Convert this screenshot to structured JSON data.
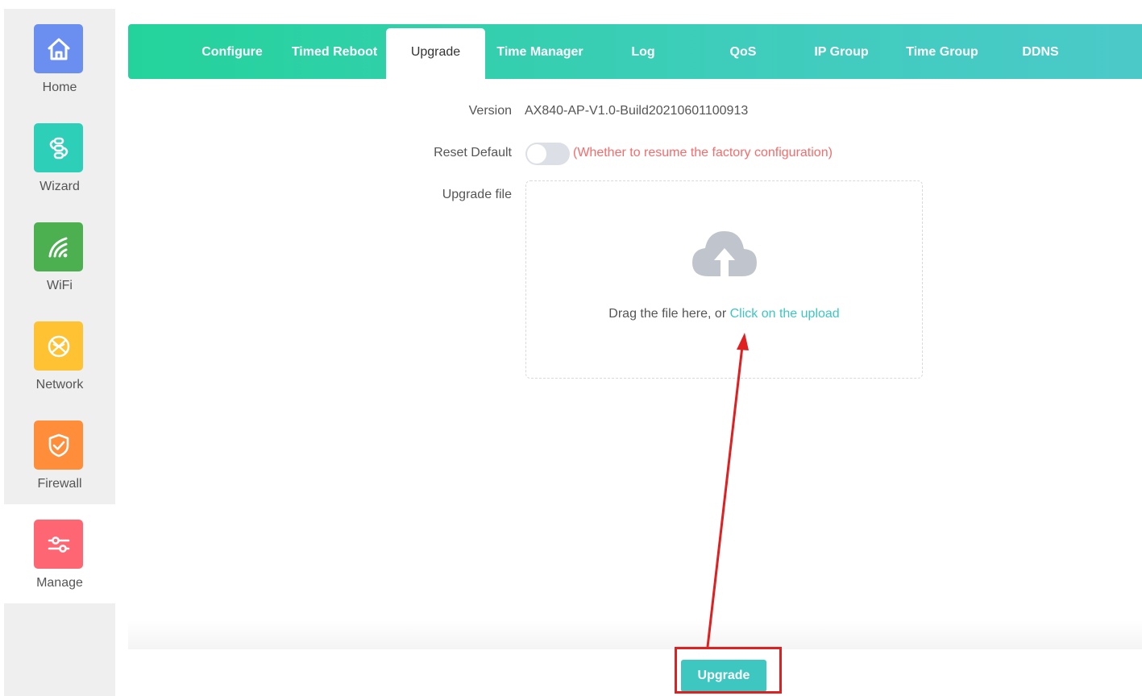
{
  "sidebar": {
    "items": [
      {
        "label": "Home",
        "icon": "home-icon",
        "color": "#6b8ff0"
      },
      {
        "label": "Wizard",
        "icon": "wizard-icon",
        "color": "#2ecfb9"
      },
      {
        "label": "WiFi",
        "icon": "wifi-icon",
        "color": "#4caf50"
      },
      {
        "label": "Network",
        "icon": "globe-icon",
        "color": "#ffc233"
      },
      {
        "label": "Firewall",
        "icon": "shield-check-icon",
        "color": "#ff8d3a"
      },
      {
        "label": "Manage",
        "icon": "sliders-icon",
        "color": "#ff6673"
      }
    ],
    "active": "Manage"
  },
  "tabs": {
    "items": [
      "Configure",
      "Timed Reboot",
      "Upgrade",
      "Time Manager",
      "Log",
      "QoS",
      "IP Group",
      "Time Group",
      "DDNS"
    ],
    "active": "Upgrade"
  },
  "form": {
    "version_label": "Version",
    "version_value": "AX840-AP-V1.0-Build20210601100913",
    "reset_label": "Reset Default",
    "reset_on": false,
    "reset_hint": "(Whether to resume the factory configuration)",
    "file_label": "Upgrade file",
    "drop_text": "Drag the file here, or",
    "drop_link": "Click on the upload",
    "upload_icon": "cloud-upload-icon"
  },
  "footer": {
    "upgrade_label": "Upgrade"
  },
  "annotation": {
    "color": "#e02020",
    "shape": "arrow from highlighted Upgrade button to upload link"
  },
  "colors": {
    "accent": "#3ec6c0",
    "tab_gradient_start": "#24d39b",
    "tab_gradient_end": "#4bc9c9",
    "hint": "#f56c6c"
  }
}
